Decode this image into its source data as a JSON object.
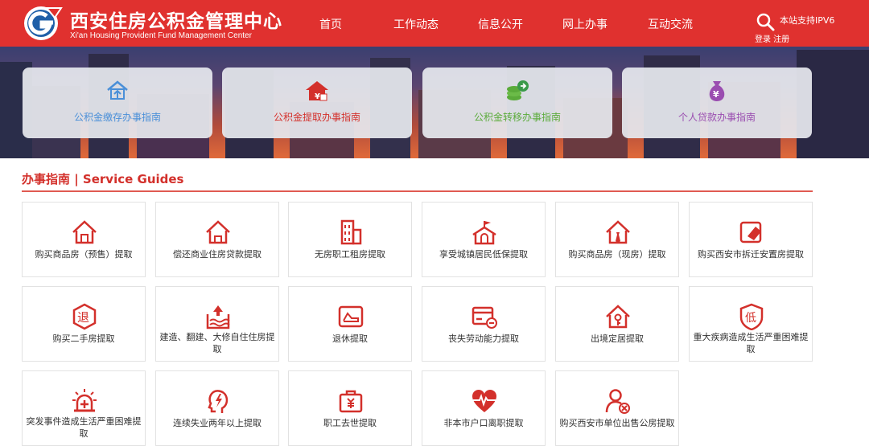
{
  "header": {
    "title": "西安住房公积金管理中心",
    "subtitle": "Xi'an Housing Provident Fund  Management Center",
    "nav": [
      "首页",
      "工作动态",
      "信息公开",
      "网上办事",
      "互动交流"
    ],
    "ipv6": "本站支持IPV6",
    "login": "登录 注册",
    "accent": "#e0312f"
  },
  "banner_cards": [
    {
      "label": "公积金缴存办事指南",
      "icon": "house-deposit-icon",
      "color": "#4a8fd8"
    },
    {
      "label": "公积金提取办事指南",
      "icon": "house-withdraw-icon",
      "color": "#d3302b"
    },
    {
      "label": "公积金转移办事指南",
      "icon": "coins-transfer-icon",
      "color": "#5aab3a"
    },
    {
      "label": "个人贷款办事指南",
      "icon": "money-bag-icon",
      "color": "#9a4db0"
    }
  ],
  "section": {
    "title": "办事指南 | Service Guides"
  },
  "tiles": [
    {
      "label": "购买商品房（预售）提取",
      "icon": "house-icon"
    },
    {
      "label": "偿还商业住房贷款提取",
      "icon": "house-loan-icon"
    },
    {
      "label": "无房职工租房提取",
      "icon": "building-icon"
    },
    {
      "label": "享受城镇居民低保提取",
      "icon": "school-flag-icon"
    },
    {
      "label": "购买商品房（现房）提取",
      "icon": "house-tie-icon"
    },
    {
      "label": "购买西安市拆迁安置房提取",
      "icon": "eraser-icon"
    },
    {
      "label": "购买二手房提取",
      "icon": "tui-badge-icon",
      "glyph": "退"
    },
    {
      "label": "建造、翻建、大修自住住房提取",
      "icon": "water-level-icon"
    },
    {
      "label": "退休提取",
      "icon": "recliner-icon"
    },
    {
      "label": "丧失劳动能力提取",
      "icon": "card-minus-icon"
    },
    {
      "label": "出境定居提取",
      "icon": "house-key-icon"
    },
    {
      "label": "重大疾病造成生活严重困难提取",
      "icon": "di-shield-icon",
      "glyph": "低"
    },
    {
      "label": "突发事件造成生活严重困难提取",
      "icon": "ambulance-light-icon"
    },
    {
      "label": "连续失业两年以上提取",
      "icon": "head-lightning-icon"
    },
    {
      "label": "职工去世提取",
      "icon": "briefcase-icon"
    },
    {
      "label": "非本市户口离职提取",
      "icon": "heart-pulse-icon"
    },
    {
      "label": "购买西安市单位出售公房提取",
      "icon": "user-remove-icon"
    }
  ]
}
